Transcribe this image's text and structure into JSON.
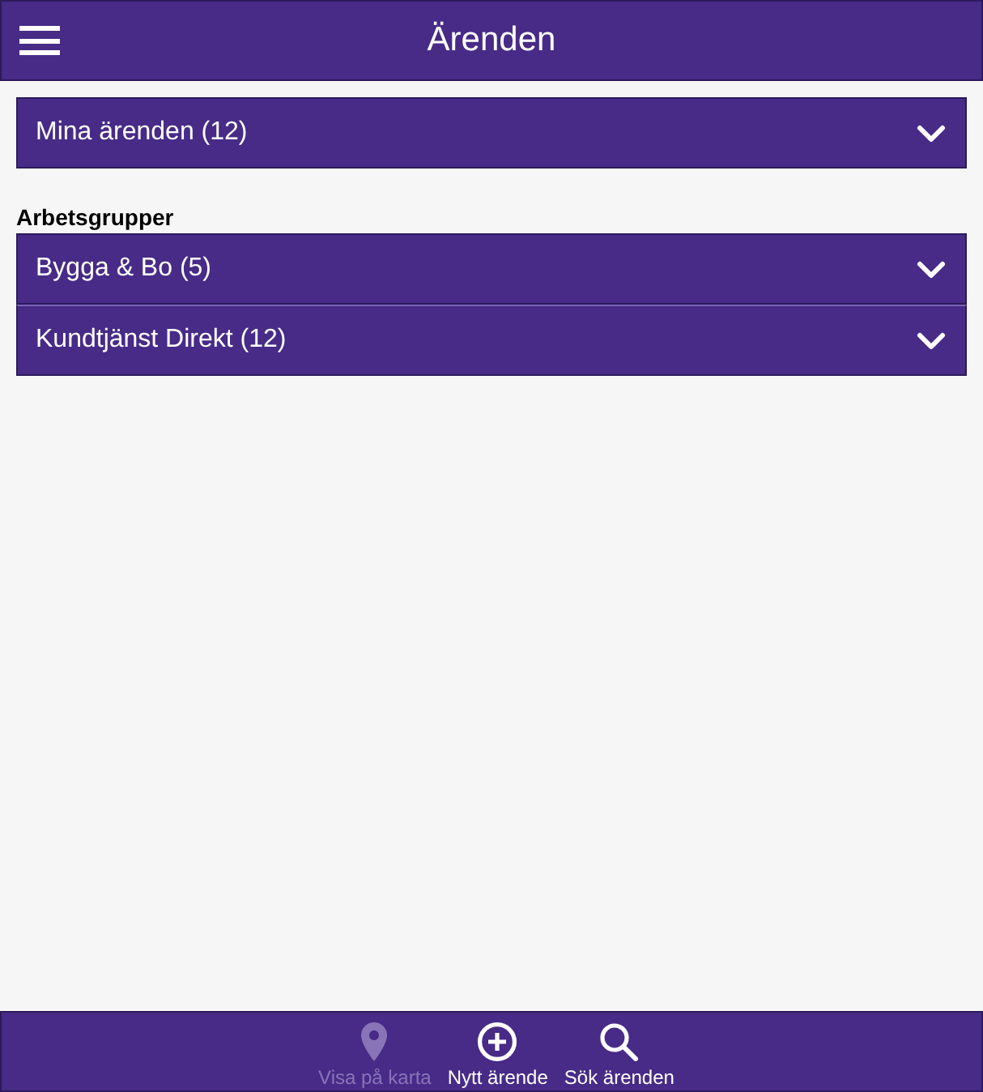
{
  "header": {
    "title": "Ärenden"
  },
  "my_cases": {
    "label": "Mina ärenden (12)",
    "expanded": false
  },
  "work_groups": {
    "heading": "Arbetsgrupper",
    "items": [
      {
        "label": "Bygga & Bo (5)",
        "expanded": false
      },
      {
        "label": "Kundtjänst Direkt (12)",
        "expanded": false
      }
    ]
  },
  "bottom_bar": [
    {
      "kind": "map",
      "label": "Visa på karta",
      "disabled": true
    },
    {
      "kind": "add",
      "label": "Nytt ärende",
      "disabled": false
    },
    {
      "kind": "search",
      "label": "Sök ärenden",
      "disabled": false
    }
  ]
}
